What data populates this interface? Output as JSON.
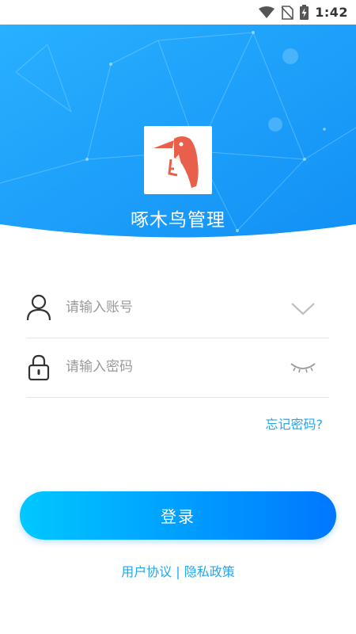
{
  "status_bar": {
    "time": "1:42",
    "icons": [
      "wifi-icon",
      "no-sim-icon",
      "battery-charging-icon"
    ]
  },
  "header": {
    "app_title": "啄木鸟管理",
    "logo": "woodpecker-logo"
  },
  "form": {
    "account": {
      "placeholder": "请输入账号",
      "value": "",
      "icon": "user-icon",
      "trailing_icon": "chevron-down-icon"
    },
    "password": {
      "placeholder": "请输入密码",
      "value": "",
      "icon": "lock-icon",
      "trailing_icon": "eye-closed-icon"
    },
    "forgot_password": "忘记密码?"
  },
  "login_button": "登录",
  "footer": {
    "user_agreement": "用户协议",
    "separator": " | ",
    "privacy_policy": "隐私政策"
  },
  "colors": {
    "banner_blue": "#1a9bfd",
    "accent": "#20a7f0",
    "button_gradient_start": "#00c8ff",
    "button_gradient_end": "#0077ff",
    "logo_bird": "#e8604c"
  }
}
